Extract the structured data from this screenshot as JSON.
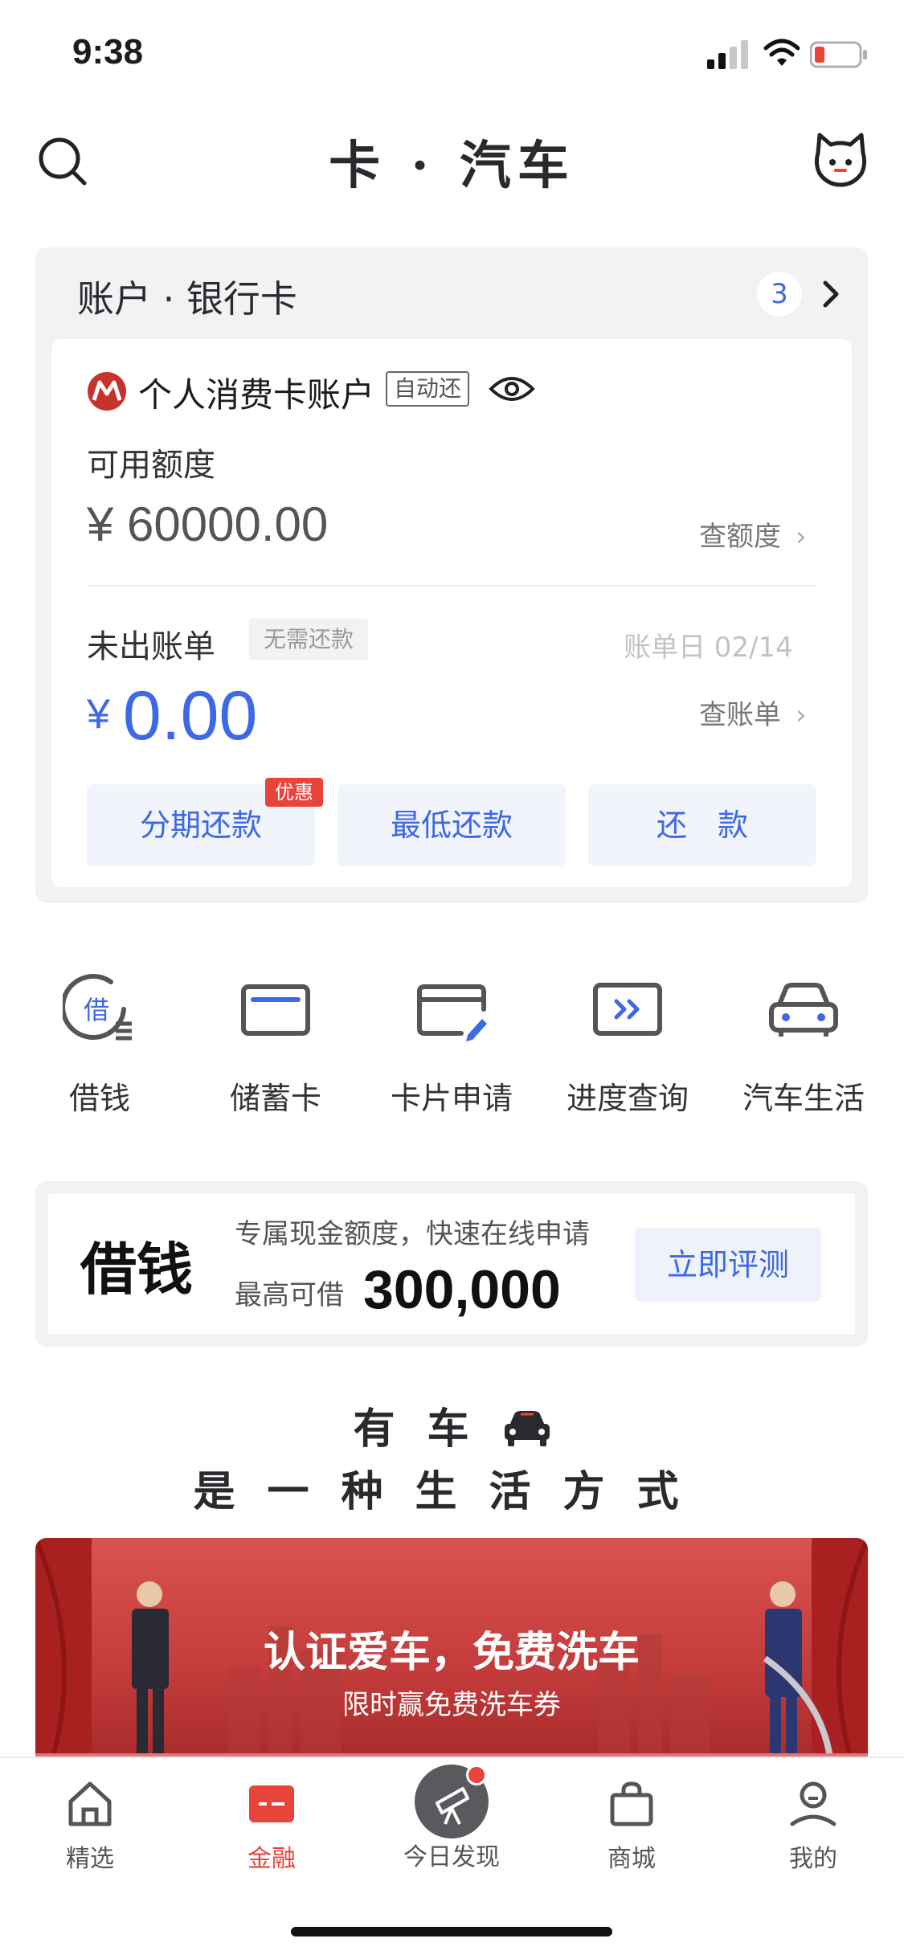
{
  "status_bar": {
    "time": "9:38"
  },
  "header": {
    "title": "卡 · 汽车"
  },
  "account": {
    "section_title": "账户 · 银行卡",
    "count": "3",
    "account_name": "个人消费卡账户",
    "auto_repay_tag": "自动还",
    "credit_label": "可用额度",
    "credit_amount": "¥ 60000.00",
    "check_credit_link": "查额度",
    "bill_label": "未出账单",
    "no_repay_tag": "无需还款",
    "bill_date": "账单日 02/14",
    "bill_currency": "¥",
    "bill_amount": "0.00",
    "check_bill_link": "查账单",
    "actions": [
      "分期还款",
      "最低还款",
      "还　款"
    ],
    "promo_tag": "优惠"
  },
  "quick_entries": [
    {
      "label": "借钱",
      "icon": "borrow-icon"
    },
    {
      "label": "储蓄卡",
      "icon": "debit-card-icon"
    },
    {
      "label": "卡片申请",
      "icon": "card-apply-icon"
    },
    {
      "label": "进度查询",
      "icon": "progress-query-icon"
    },
    {
      "label": "汽车生活",
      "icon": "car-icon"
    }
  ],
  "loan": {
    "title": "借钱",
    "desc": "专属现金额度，快速在线申请",
    "max_label": "最高可借",
    "max_value": "300,000",
    "button": "立即评测"
  },
  "slogan": {
    "line1": "有车",
    "line2": "是一种生活方式"
  },
  "promo_banner": {
    "title": "认证爱车，免费洗车",
    "subtitle": "限时赢免费洗车券"
  },
  "bottom_nav": [
    {
      "label": "精选",
      "icon": "home-icon"
    },
    {
      "label": "金融",
      "icon": "finance-card-icon",
      "active": true
    },
    {
      "label": "今日发现",
      "icon": "telescope-icon"
    },
    {
      "label": "商城",
      "icon": "shopping-bag-icon"
    },
    {
      "label": "我的",
      "icon": "profile-icon"
    }
  ],
  "colors": {
    "accent": "#3d68e6",
    "brand_red": "#e8443a",
    "panel": "#f2f2f5"
  }
}
